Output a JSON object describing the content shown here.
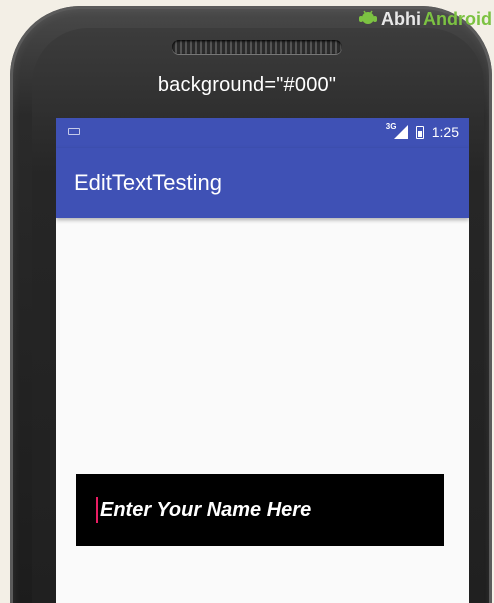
{
  "caption": "background=\"#000\"",
  "watermark": {
    "part_a": "Abhi",
    "part_b": "Android"
  },
  "status_bar": {
    "network": "3G",
    "time": "1:25"
  },
  "app_bar": {
    "title": "EditTextTesting"
  },
  "edit_text": {
    "hint": "Enter Your Name Here",
    "value": ""
  },
  "colors": {
    "primary": "#3f51b5",
    "edit_text_background": "#000000",
    "cursor": "#e91e63",
    "screen_background": "#fafafa"
  },
  "icons": [
    "keyboard-icon",
    "signal-icon",
    "battery-icon",
    "watermark-logo-icon"
  ]
}
